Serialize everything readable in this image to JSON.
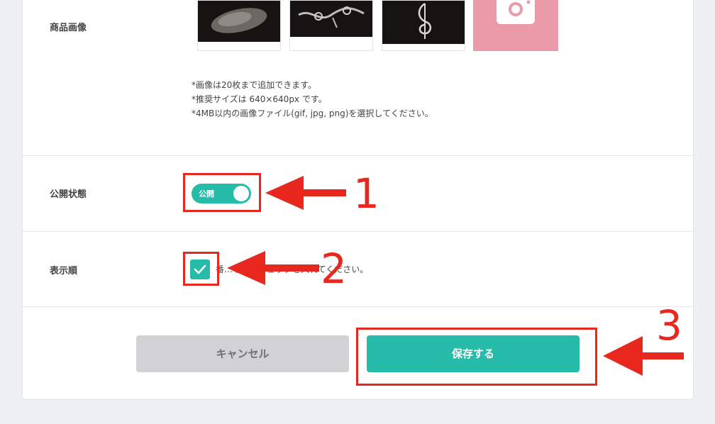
{
  "form": {
    "image_label": "商品画像",
    "image_notes": [
      "*画像は20枚まで追加できます。",
      "*推奨サイズは 640×640px です。",
      "*4MB以内の画像ファイル(gif, jpg, png)を選択してください。"
    ],
    "status_label": "公開状態",
    "status_toggle": {
      "text": "公開",
      "on": true
    },
    "order_label": "表示順",
    "order_hint": "番…場合はチェックを入れてください。",
    "order_checked": true
  },
  "buttons": {
    "cancel": "キャンセル",
    "save": "保存する"
  },
  "annotations": {
    "step1": "1",
    "step2": "2",
    "step3": "3"
  },
  "colors": {
    "accent": "#27bcaa",
    "annotation_red": "#e8281f",
    "cancel_bg": "#d2d2d4",
    "photo_add_bg": "#ea9aa8"
  },
  "icons": {
    "add_photo": "camera-icon",
    "check": "check-icon"
  }
}
